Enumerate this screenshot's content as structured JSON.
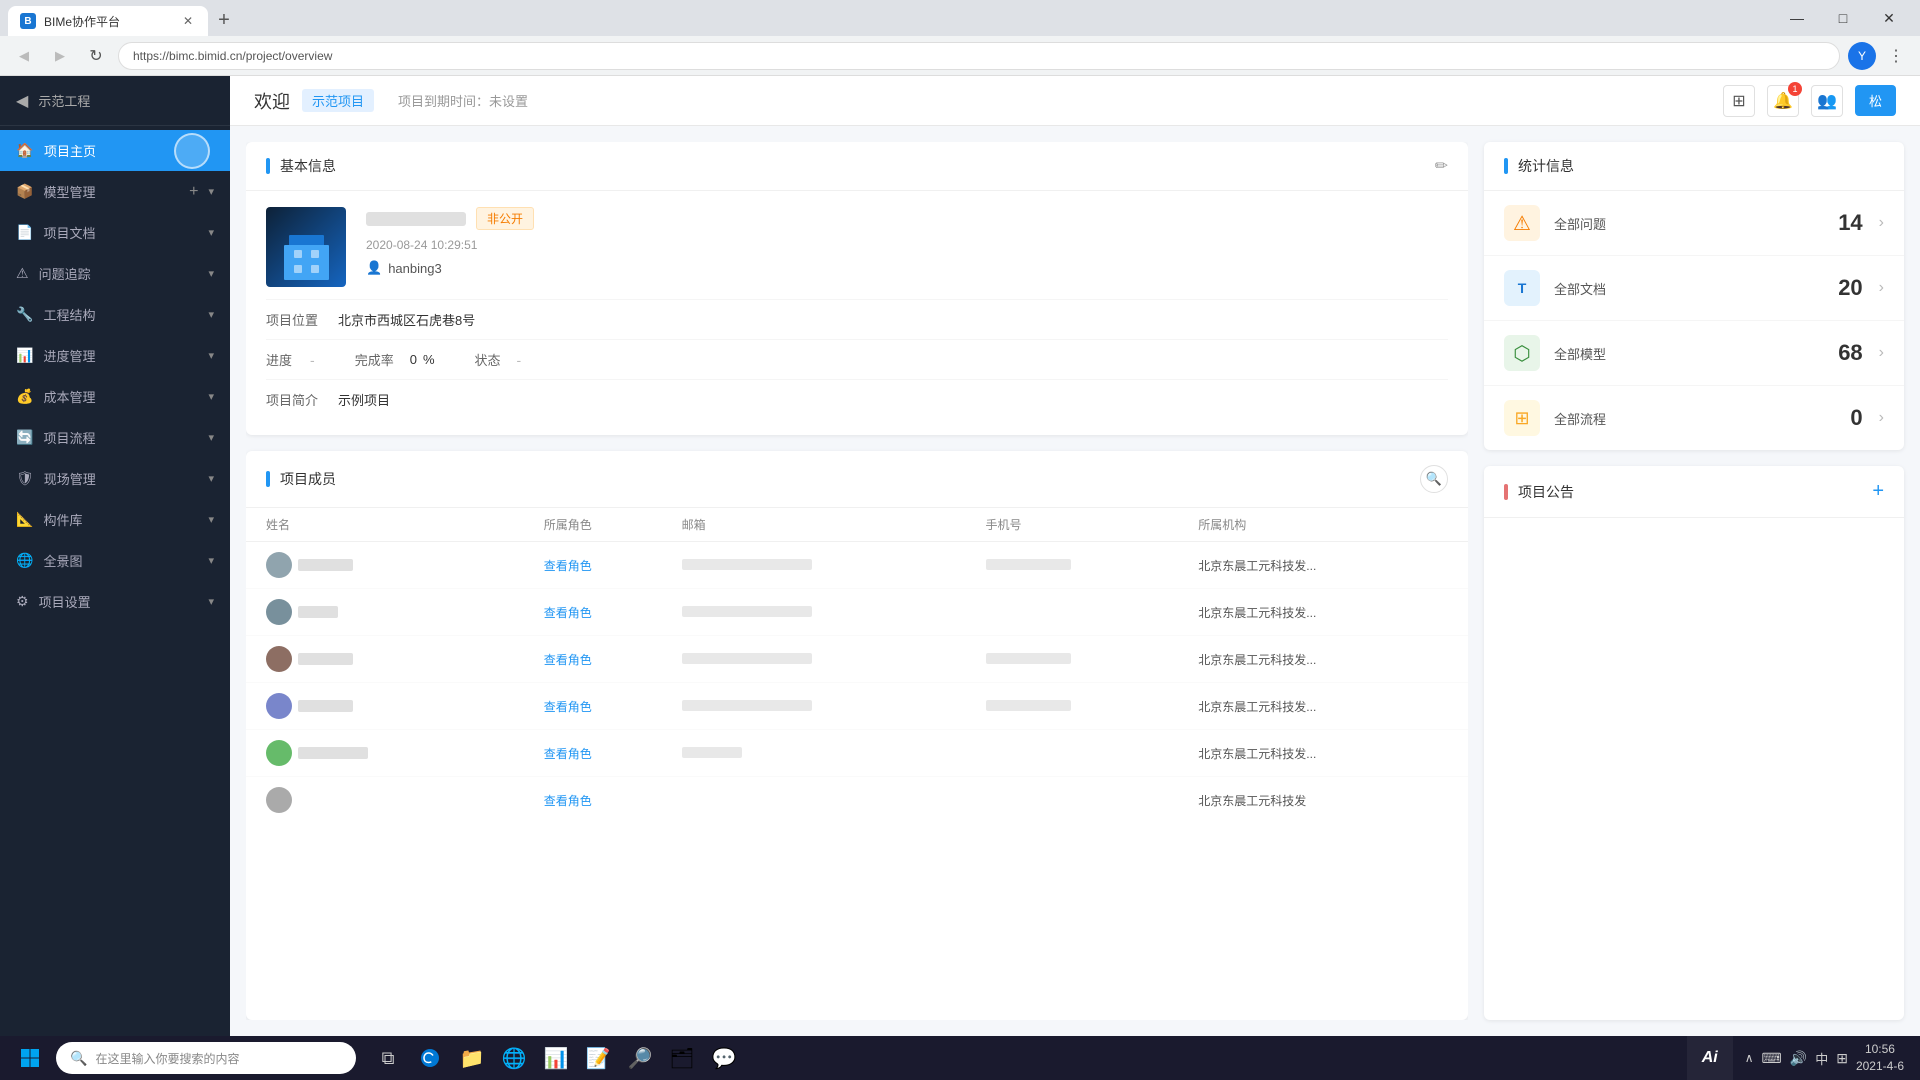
{
  "browser": {
    "tab_title": "BIMe协作平台",
    "favicon_text": "B",
    "new_tab_label": "+",
    "address": "https://bimc.bimid.cn/project/overview",
    "window_minimize": "—",
    "window_maximize": "□",
    "window_close": "✕"
  },
  "header": {
    "welcome": "欢迎",
    "project_tag": "示范项目",
    "deadline_label": "项目到期时间：未设置",
    "logout": "松"
  },
  "sidebar": {
    "back_label": "返回",
    "project_name": "示范工程",
    "items": [
      {
        "id": "home",
        "label": "项目主页",
        "icon": "🏠",
        "active": true,
        "has_add": false,
        "has_chevron": false
      },
      {
        "id": "model",
        "label": "模型管理",
        "icon": "📦",
        "active": false,
        "has_add": true,
        "has_chevron": true
      },
      {
        "id": "docs",
        "label": "项目文档",
        "icon": "📄",
        "active": false,
        "has_add": false,
        "has_chevron": true
      },
      {
        "id": "issues",
        "label": "问题追踪",
        "icon": "⚠",
        "active": false,
        "has_add": false,
        "has_chevron": true
      },
      {
        "id": "structure",
        "label": "工程结构",
        "icon": "🔧",
        "active": false,
        "has_add": false,
        "has_chevron": true
      },
      {
        "id": "progress",
        "label": "进度管理",
        "icon": "📊",
        "active": false,
        "has_add": false,
        "has_chevron": true
      },
      {
        "id": "cost",
        "label": "成本管理",
        "icon": "💰",
        "active": false,
        "has_add": false,
        "has_chevron": true
      },
      {
        "id": "workflow",
        "label": "项目流程",
        "icon": "🔄",
        "active": false,
        "has_add": false,
        "has_chevron": true
      },
      {
        "id": "field",
        "label": "现场管理",
        "icon": "🛡",
        "active": false,
        "has_add": false,
        "has_chevron": true
      },
      {
        "id": "parts",
        "label": "构件库",
        "icon": "📐",
        "active": false,
        "has_add": false,
        "has_chevron": true
      },
      {
        "id": "panorama",
        "label": "全景图",
        "icon": "🌐",
        "active": false,
        "has_add": false,
        "has_chevron": true
      },
      {
        "id": "settings",
        "label": "项目设置",
        "icon": "⚙",
        "active": false,
        "has_add": false,
        "has_chevron": true
      }
    ]
  },
  "basic_info": {
    "section_title": "基本信息",
    "status_badge": "非公开",
    "date": "2020-08-24 10:29:51",
    "owner": "hanbing3",
    "location_label": "项目位置",
    "location_value": "北京市西城区石虎巷8号",
    "progress_label": "进度",
    "progress_value": "-",
    "completion_label": "完成率",
    "completion_value": "0",
    "completion_pct": "%",
    "status_label": "状态",
    "status_value": "-",
    "desc_label": "项目简介",
    "desc_value": "示例项目"
  },
  "stats": {
    "section_title": "统计信息",
    "items": [
      {
        "id": "issues",
        "label": "全部问题",
        "count": "14",
        "icon_type": "warning"
      },
      {
        "id": "docs",
        "label": "全部文档",
        "count": "20",
        "icon_type": "doc"
      },
      {
        "id": "models",
        "label": "全部模型",
        "count": "68",
        "icon_type": "model"
      },
      {
        "id": "flows",
        "label": "全部流程",
        "count": "0",
        "icon_type": "flow"
      }
    ]
  },
  "members": {
    "section_title": "项目成员",
    "columns": [
      "姓名",
      "所属角色",
      "邮箱",
      "手机号",
      "所属机构"
    ],
    "rows": [
      {
        "id": 1,
        "role_text": "查看角色",
        "org": "北京东晨工元科技发..."
      },
      {
        "id": 2,
        "role_text": "查看角色",
        "org": "北京东晨工元科技发..."
      },
      {
        "id": 3,
        "role_text": "查看角色",
        "org": "北京东晨工元科技发..."
      },
      {
        "id": 4,
        "role_text": "查看角色",
        "org": "北京东晨工元科技发..."
      },
      {
        "id": 5,
        "role_text": "查看角色",
        "org": "北京东晨工元科技发..."
      },
      {
        "id": 6,
        "role_text": "查看角色",
        "org": "北京东晨工元科技发..."
      }
    ]
  },
  "announcement": {
    "section_title": "项目公告"
  },
  "taskbar": {
    "search_placeholder": "在这里输入你要搜索的内容",
    "time": "10:56",
    "date": "2021-4-6",
    "ai_label": "Ai"
  }
}
